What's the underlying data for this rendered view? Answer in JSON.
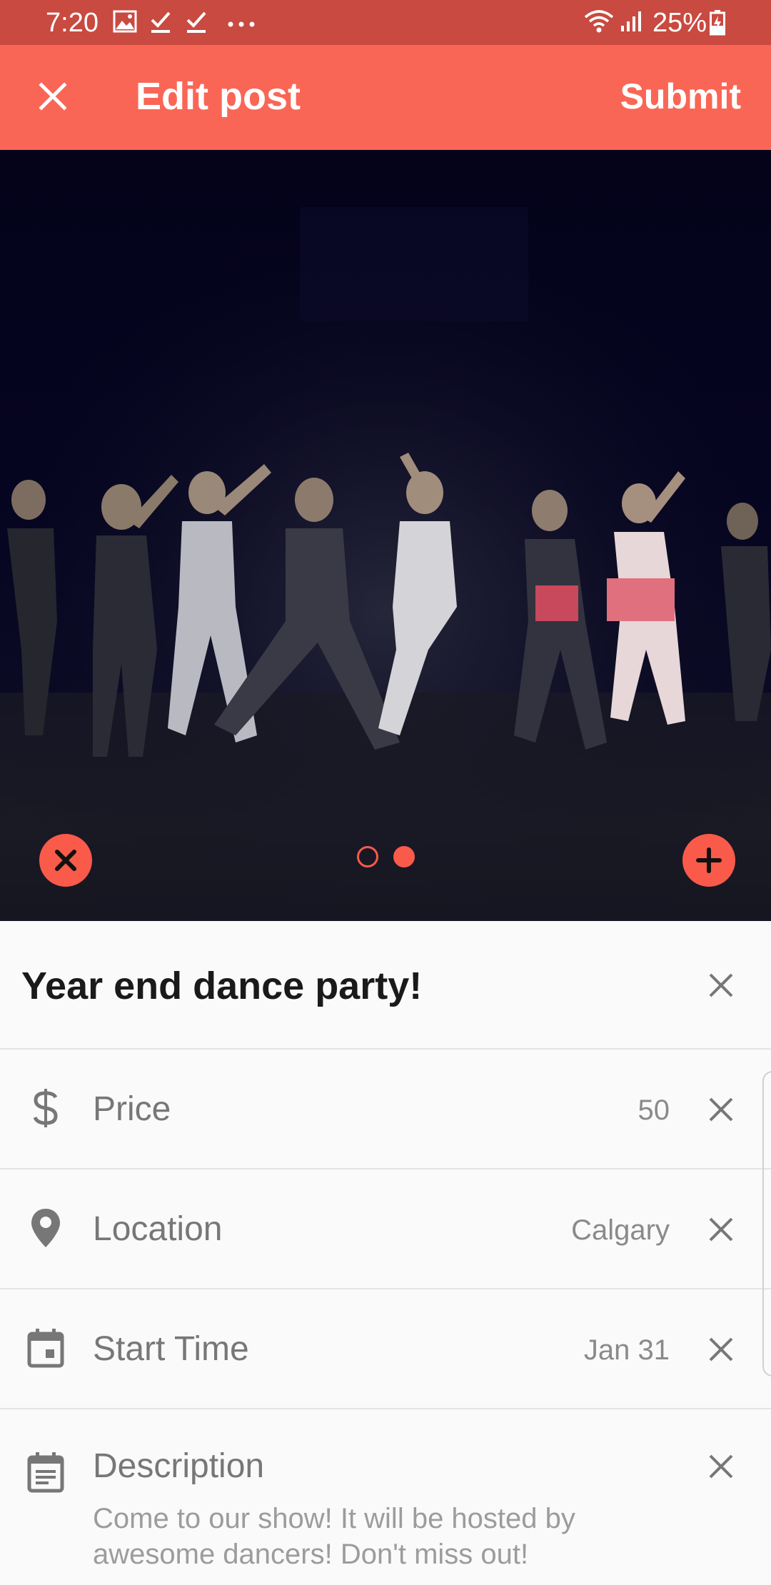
{
  "status_bar": {
    "time": "7:20",
    "battery": "25%",
    "icons": [
      "image-icon",
      "check-icon",
      "check-icon",
      "more-dots-icon",
      "wifi-icon",
      "signal-icon",
      "battery-charging-icon"
    ]
  },
  "app_bar": {
    "close_icon": "close-icon",
    "title": "Edit post",
    "submit_label": "Submit"
  },
  "gallery": {
    "image_subject": "dancers on stage",
    "page_count": 2,
    "active_page": 2,
    "remove_icon": "remove-image-icon",
    "add_icon": "add-image-icon",
    "accent_color": "#fa5a4a"
  },
  "post": {
    "title": "Year end dance party!",
    "fields": {
      "price": {
        "icon": "dollar-icon",
        "label": "Price",
        "value": "50"
      },
      "location": {
        "icon": "location-pin-icon",
        "label": "Location",
        "value": "Calgary"
      },
      "start_time": {
        "icon": "calendar-icon",
        "label": "Start Time",
        "value": "Jan 31"
      },
      "description": {
        "icon": "notes-icon",
        "label": "Description",
        "value": "Come to our show! It will be hosted by awesome dancers! Don't miss out!"
      }
    }
  },
  "colors": {
    "status_bar": "#c94a40",
    "app_bar": "#fa6656",
    "accent": "#fa5a4a"
  }
}
